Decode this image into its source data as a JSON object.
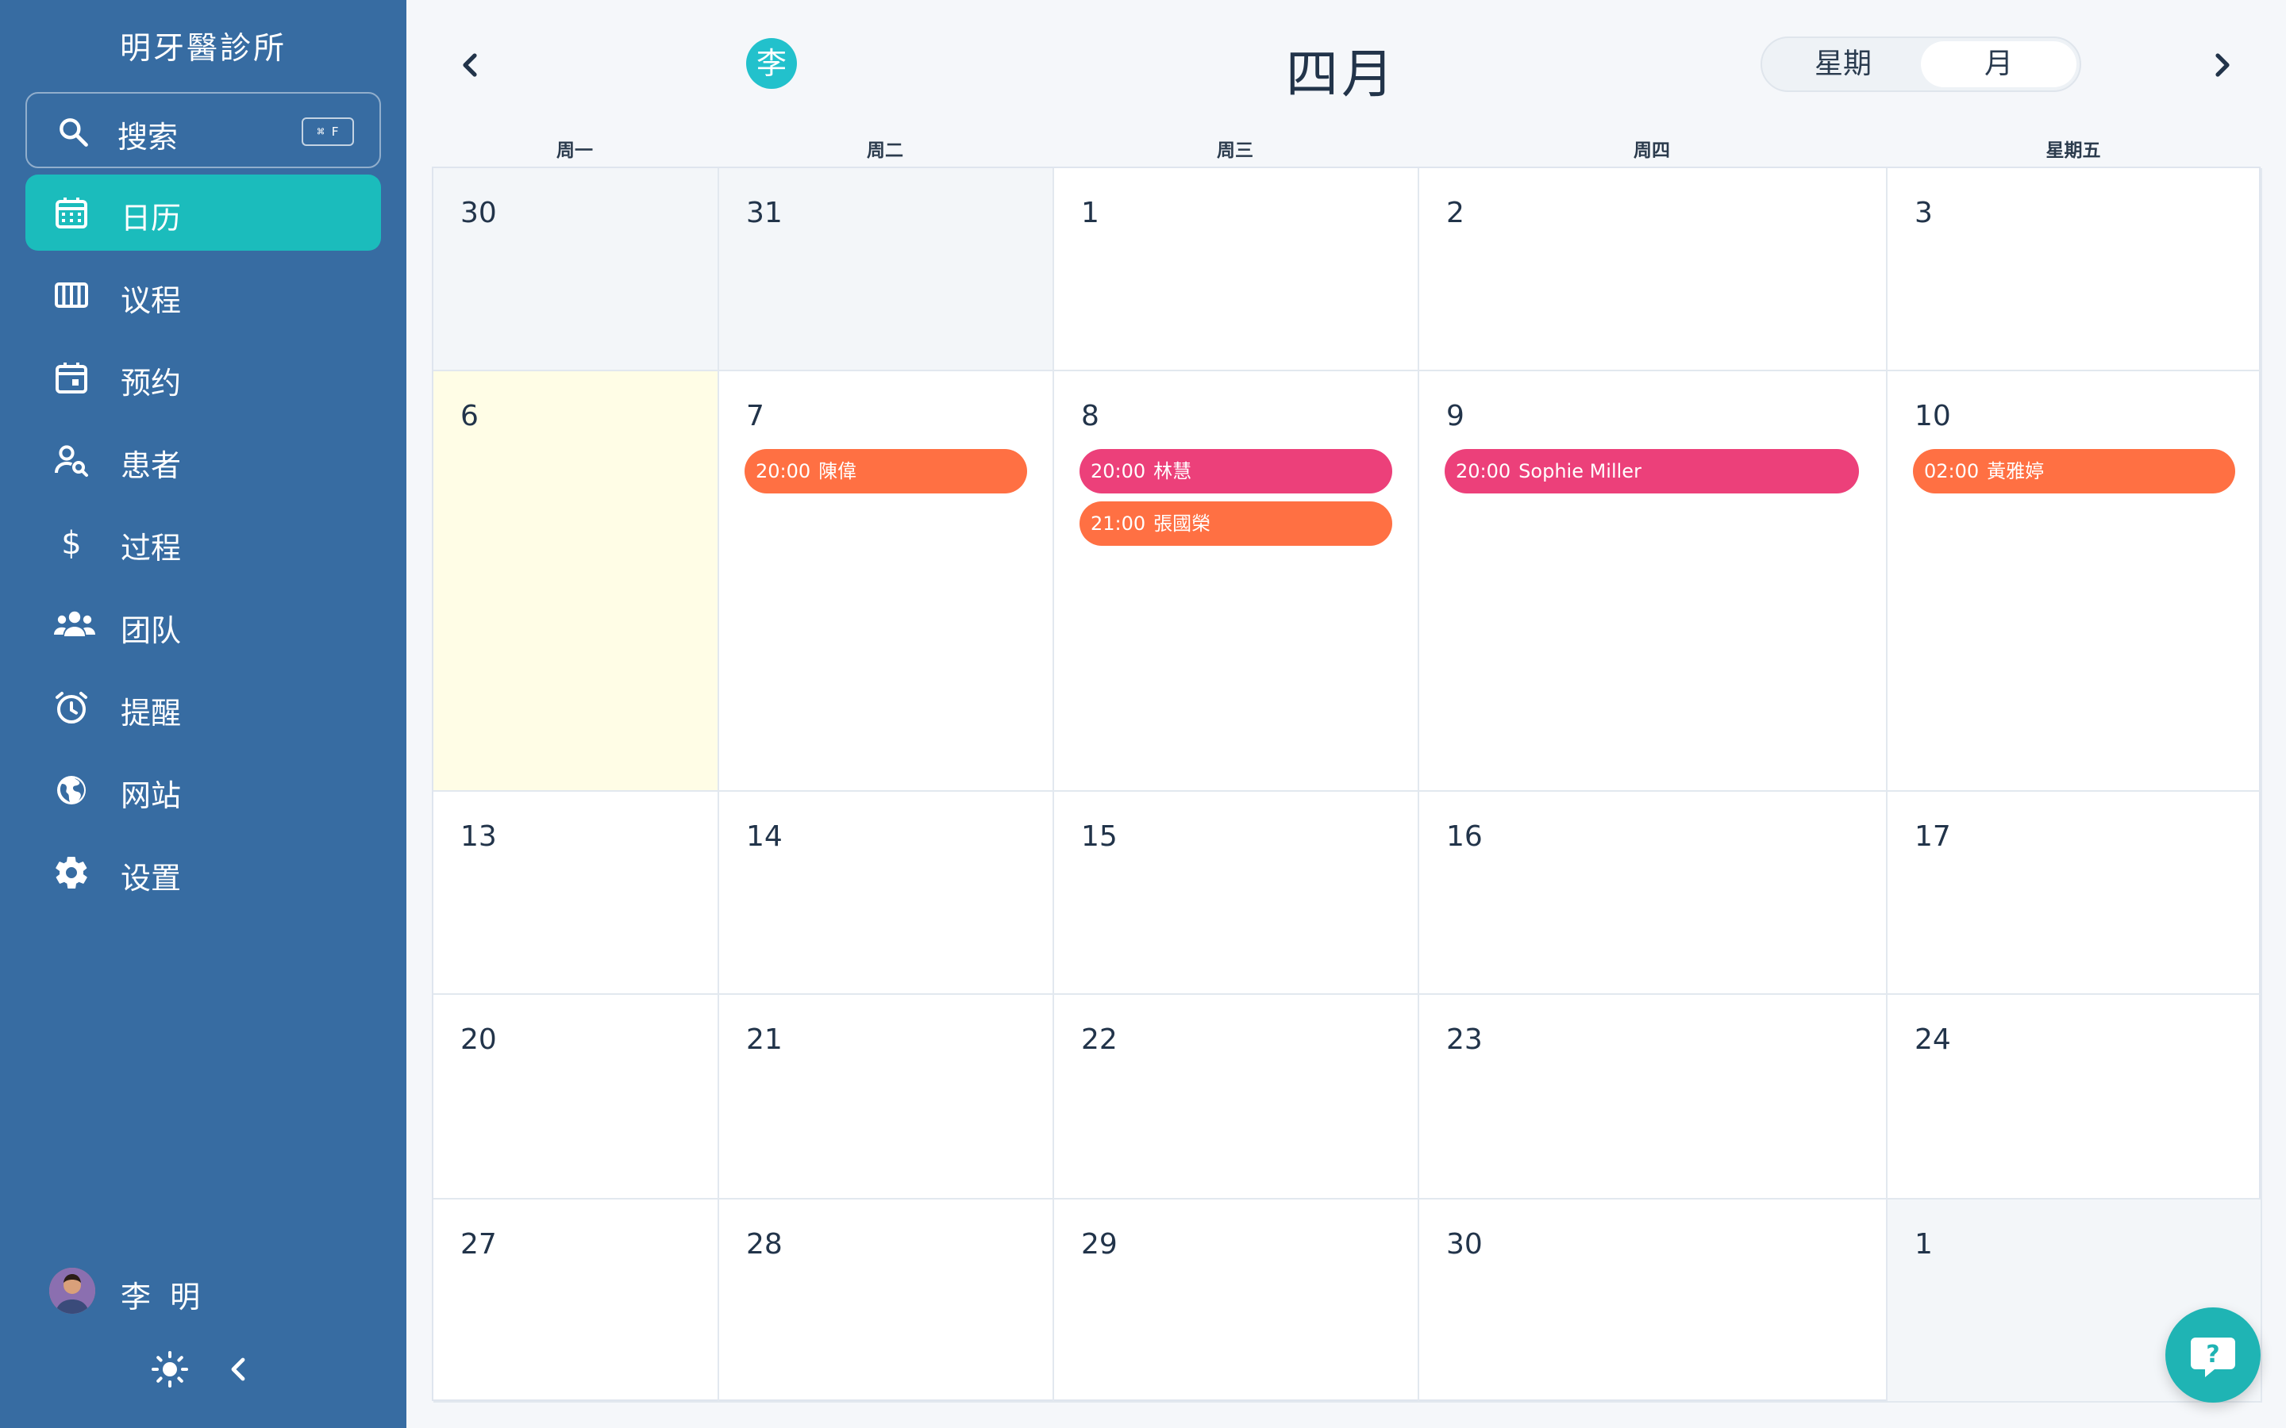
{
  "sidebar": {
    "clinic_name": "明牙醫診所",
    "search": {
      "label": "搜索",
      "shortcut": "⌘ F"
    },
    "nav": [
      {
        "label": "日历",
        "icon": "calendar-icon",
        "active": true
      },
      {
        "label": "议程",
        "icon": "columns-icon",
        "active": false
      },
      {
        "label": "预约",
        "icon": "appointment-icon",
        "active": false
      },
      {
        "label": "患者",
        "icon": "patient-search-icon",
        "active": false
      },
      {
        "label": "过程",
        "icon": "dollar-icon",
        "active": false
      },
      {
        "label": "团队",
        "icon": "team-icon",
        "active": false
      },
      {
        "label": "提醒",
        "icon": "alarm-icon",
        "active": false
      },
      {
        "label": "网站",
        "icon": "globe-icon",
        "active": false
      },
      {
        "label": "设置",
        "icon": "gear-icon",
        "active": false
      }
    ],
    "user": {
      "name": "李 明"
    }
  },
  "header": {
    "person_badge": "李",
    "month_title": "四月",
    "view_options": {
      "week": "星期",
      "month": "月"
    },
    "selected_view": "月"
  },
  "calendar": {
    "weekdays": [
      "周一",
      "周二",
      "周三",
      "周四",
      "星期五"
    ],
    "weeks": [
      [
        {
          "day": "30",
          "other": true
        },
        {
          "day": "31",
          "other": true
        },
        {
          "day": "1"
        },
        {
          "day": "2"
        },
        {
          "day": "3"
        }
      ],
      [
        {
          "day": "6",
          "today": true
        },
        {
          "day": "7",
          "events": [
            {
              "time": "20:00",
              "name": "陳偉",
              "color": "#ff7043"
            }
          ]
        },
        {
          "day": "8",
          "events": [
            {
              "time": "20:00",
              "name": "林慧",
              "color": "#ec407a"
            },
            {
              "time": "21:00",
              "name": "張國榮",
              "color": "#ff7043"
            }
          ]
        },
        {
          "day": "9",
          "events": [
            {
              "time": "20:00",
              "name": "Sophie Miller",
              "color": "#ec407a"
            }
          ]
        },
        {
          "day": "10",
          "events": [
            {
              "time": "02:00",
              "name": "黃雅婷",
              "color": "#ff7043"
            }
          ]
        }
      ],
      [
        {
          "day": "13"
        },
        {
          "day": "14"
        },
        {
          "day": "15"
        },
        {
          "day": "16"
        },
        {
          "day": "17"
        }
      ],
      [
        {
          "day": "20"
        },
        {
          "day": "21"
        },
        {
          "day": "22"
        },
        {
          "day": "23"
        },
        {
          "day": "24"
        }
      ],
      [
        {
          "day": "27"
        },
        {
          "day": "28"
        },
        {
          "day": "29"
        },
        {
          "day": "30"
        },
        {
          "day": "1",
          "other": true
        }
      ]
    ]
  },
  "colors": {
    "sidebar_bg": "#376ca2",
    "active_nav": "#1bbcbc",
    "event_orange": "#ff7043",
    "event_pink": "#ec407a",
    "today_bg": "#fffde6",
    "help_fab": "#1fb4b4"
  }
}
